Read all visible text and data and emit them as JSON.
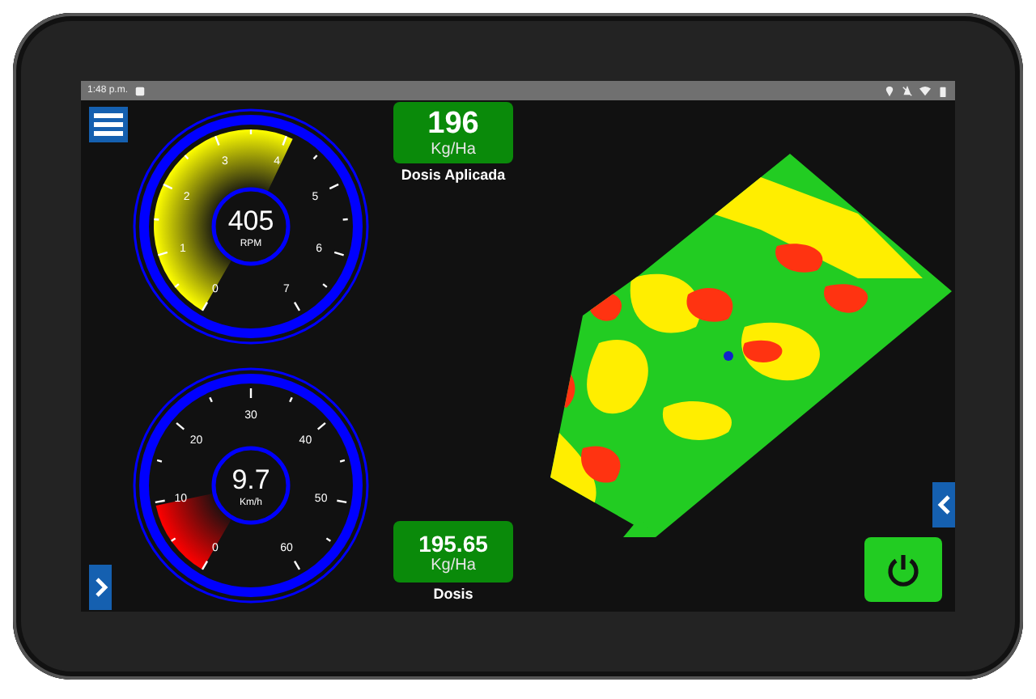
{
  "status_bar": {
    "time": "1:48 p.m."
  },
  "gauges": [
    {
      "value": "405",
      "unit": "RPM",
      "scale": [
        "0",
        "1",
        "2",
        "3",
        "4",
        "5",
        "6",
        "7"
      ]
    },
    {
      "value": "9.7",
      "unit": "Km/h",
      "scale": [
        "0",
        "10",
        "20",
        "30",
        "40",
        "50",
        "60"
      ]
    }
  ],
  "readouts": [
    {
      "value": "196",
      "unit": "Kg/Ha",
      "label": "Dosis Aplicada"
    },
    {
      "value": "195.65",
      "unit": "Kg/Ha",
      "label": "Dosis"
    }
  ]
}
